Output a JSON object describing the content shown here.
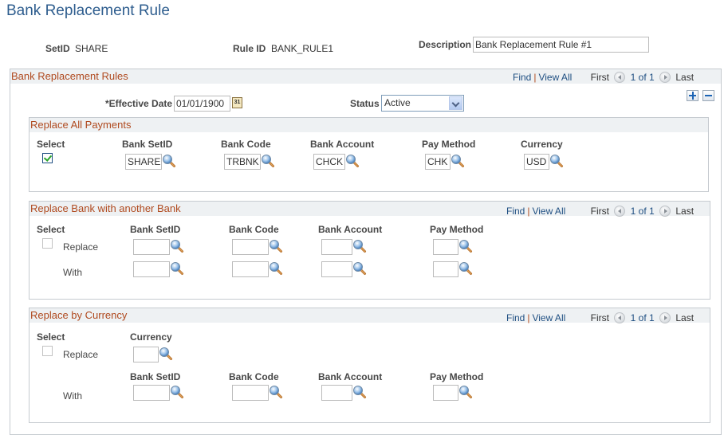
{
  "page": {
    "title": "Bank Replacement Rule"
  },
  "header": {
    "setid_label": "SetID",
    "setid_value": "SHARE",
    "ruleid_label": "Rule ID",
    "ruleid_value": "BANK_RULE1",
    "description_label": "Description",
    "description_value": "Bank Replacement Rule #1"
  },
  "rules": {
    "title": "Bank Replacement Rules",
    "find": "Find",
    "view_all": "View All",
    "first": "First",
    "count": "1 of 1",
    "last": "Last",
    "effective_date_label": "*Effective Date",
    "effective_date_value": "01/01/1900",
    "status_label": "Status",
    "status_value": "Active",
    "add_row": "+",
    "delete_row": "-"
  },
  "replace_all": {
    "title": "Replace All Payments",
    "columns": [
      "Select",
      "Bank SetID",
      "Bank Code",
      "Bank Account",
      "Pay Method",
      "Currency"
    ],
    "selected": true,
    "values": {
      "bank_setid": "SHARE",
      "bank_code": "TRBNK",
      "bank_account": "CHCK",
      "pay_method": "CHK",
      "currency": "USD"
    }
  },
  "replace_bank": {
    "title": "Replace Bank with another Bank",
    "find": "Find",
    "view_all": "View All",
    "first": "First",
    "count": "1 of 1",
    "last": "Last",
    "columns": [
      "Select",
      "Bank SetID",
      "Bank Code",
      "Bank Account",
      "Pay Method"
    ],
    "selected": false,
    "row_replace_label": "Replace",
    "row_with_label": "With",
    "replace_values": {
      "bank_setid": "",
      "bank_code": "",
      "bank_account": "",
      "pay_method": ""
    },
    "with_values": {
      "bank_setid": "",
      "bank_code": "",
      "bank_account": "",
      "pay_method": ""
    }
  },
  "replace_currency": {
    "title": "Replace by Currency",
    "find": "Find",
    "view_all": "View All",
    "first": "First",
    "count": "1 of 1",
    "last": "Last",
    "select_label": "Select",
    "currency_label": "Currency",
    "selected": false,
    "row_replace_label": "Replace",
    "row_with_label": "With",
    "currency_value": "",
    "with_columns": [
      "Bank SetID",
      "Bank Code",
      "Bank Account",
      "Pay Method"
    ],
    "with_values": {
      "bank_setid": "",
      "bank_code": "",
      "bank_account": "",
      "pay_method": ""
    }
  },
  "icons": {
    "lookup": "magnifier-lookup-icon",
    "calendar": "calendar-icon",
    "calendar_text": "31",
    "prev": "previous-arrow-icon",
    "next": "next-arrow-icon"
  },
  "colors": {
    "title": "#2e5d8e",
    "section_title": "#b04a1f",
    "link": "#1f4f82",
    "header_bg": "#eef1f3",
    "border": "#c6cbd0"
  }
}
